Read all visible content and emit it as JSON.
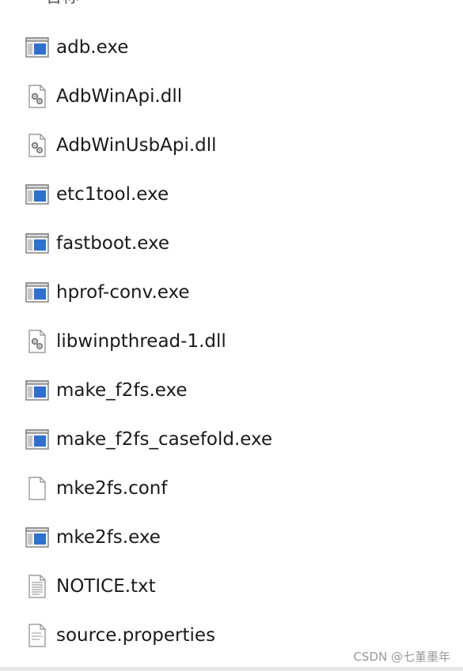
{
  "header": {
    "column_label": "名称"
  },
  "files": [
    {
      "name": "adb.exe",
      "icon": "exe-icon"
    },
    {
      "name": "AdbWinApi.dll",
      "icon": "dll-icon"
    },
    {
      "name": "AdbWinUsbApi.dll",
      "icon": "dll-icon"
    },
    {
      "name": "etc1tool.exe",
      "icon": "exe-icon"
    },
    {
      "name": "fastboot.exe",
      "icon": "exe-icon"
    },
    {
      "name": "hprof-conv.exe",
      "icon": "exe-icon"
    },
    {
      "name": "libwinpthread-1.dll",
      "icon": "dll-icon"
    },
    {
      "name": "make_f2fs.exe",
      "icon": "exe-icon"
    },
    {
      "name": "make_f2fs_casefold.exe",
      "icon": "exe-icon"
    },
    {
      "name": "mke2fs.conf",
      "icon": "blank-file-icon"
    },
    {
      "name": "mke2fs.exe",
      "icon": "exe-icon"
    },
    {
      "name": "NOTICE.txt",
      "icon": "text-file-icon"
    },
    {
      "name": "source.properties",
      "icon": "properties-file-icon"
    }
  ],
  "watermark": "CSDN @七堇墨年",
  "colors": {
    "exe_blue": "#2f6fcf",
    "text": "#1a1a1a"
  }
}
